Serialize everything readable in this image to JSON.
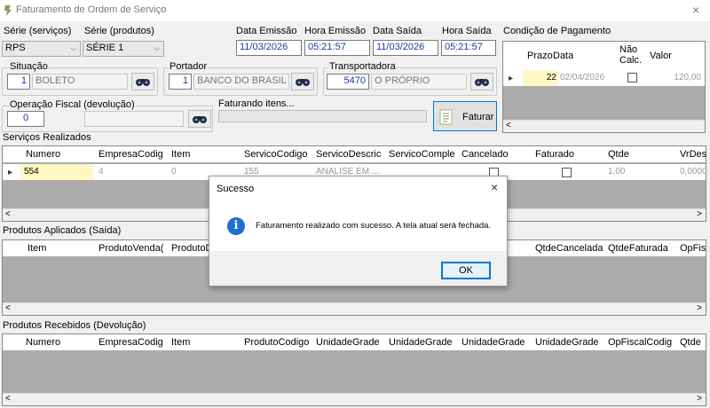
{
  "window": {
    "title": "Faturamento de Ordem de Serviço",
    "close": "×"
  },
  "serie_servicos": {
    "label": "Série (serviços)",
    "value": "RPS"
  },
  "serie_produtos": {
    "label": "Série (produtos)",
    "value": "SÉRIE 1"
  },
  "data_emissao": {
    "label": "Data Emissão",
    "value": "11/03/2026"
  },
  "hora_emissao": {
    "label": "Hora Emissão",
    "value": "05:21:57"
  },
  "data_saida": {
    "label": "Data Saída",
    "value": "11/03/2026"
  },
  "hora_saida": {
    "label": "Hora Saída",
    "value": "05:21:57"
  },
  "situacao": {
    "label": "Situação",
    "code": "1",
    "desc": "BOLETO"
  },
  "portador": {
    "label": "Portador",
    "code": "1",
    "desc": "BANCO DO BRASIL"
  },
  "transportadora": {
    "label": "Transportadora",
    "code": "5470",
    "desc": "O PRÓPRIO"
  },
  "operacao_fiscal": {
    "label": "Operação Fiscal (devolução)",
    "code": "0",
    "desc": ""
  },
  "faturando": {
    "label": "Faturando itens..."
  },
  "faturar_button": {
    "label": "Faturar"
  },
  "pagamento": {
    "label": "Condição de Pagamento",
    "columns": [
      "Prazo",
      "Data",
      "Não Calc.",
      "Valor"
    ],
    "nao_calc_lines": [
      "Não",
      "Calc."
    ],
    "rows": [
      {
        "prazo": "22",
        "data": "02/04/2026",
        "nao_calc": false,
        "valor": "120,00"
      }
    ]
  },
  "servicos": {
    "label": "Serviços Realizados",
    "columns": [
      "Numero",
      "EmpresaCodig",
      "Item",
      "ServicoCodigo",
      "ServicoDescric",
      "ServicoComple",
      "Cancelado",
      "Faturado",
      "Qtde",
      "VrDes"
    ],
    "rows": [
      {
        "numero": "554",
        "empresa": "4",
        "item": "0",
        "servico_codigo": "155",
        "servico_desc": "ANALISE EM ...",
        "qtde": "1,00",
        "vrdes": "0,0000"
      }
    ]
  },
  "produtos_aplicados": {
    "label": "Produtos Aplicados (Saída)",
    "columns": [
      "Item",
      "ProdutoVenda(",
      "ProdutoD",
      "QtdeCancelada",
      "QtdeFaturada",
      "OpFis"
    ]
  },
  "produtos_recebidos": {
    "label": "Produtos Recebidos (Devolução)",
    "columns": [
      "Numero",
      "EmpresaCodig",
      "Item",
      "ProdutoCodigo",
      "UnidadeGrade",
      "UnidadeGrade",
      "UnidadeGrade",
      "UnidadeGrade",
      "OpFiscalCodig",
      "Qtde"
    ]
  },
  "dialog": {
    "title": "Sucesso",
    "close": "×",
    "message": "Faturamento realizado com sucesso. A tela atual será fechada.",
    "ok": "OK",
    "icon_glyph": "i"
  },
  "glyphs": {
    "arrow_down": "⌵",
    "row_indicator": "▸",
    "scroll_left": "<",
    "scroll_right": ">"
  },
  "colors": {
    "accent": "#0078d7",
    "highlight_cell": "#fff7c4",
    "info_blue": "#1d6fd6"
  }
}
